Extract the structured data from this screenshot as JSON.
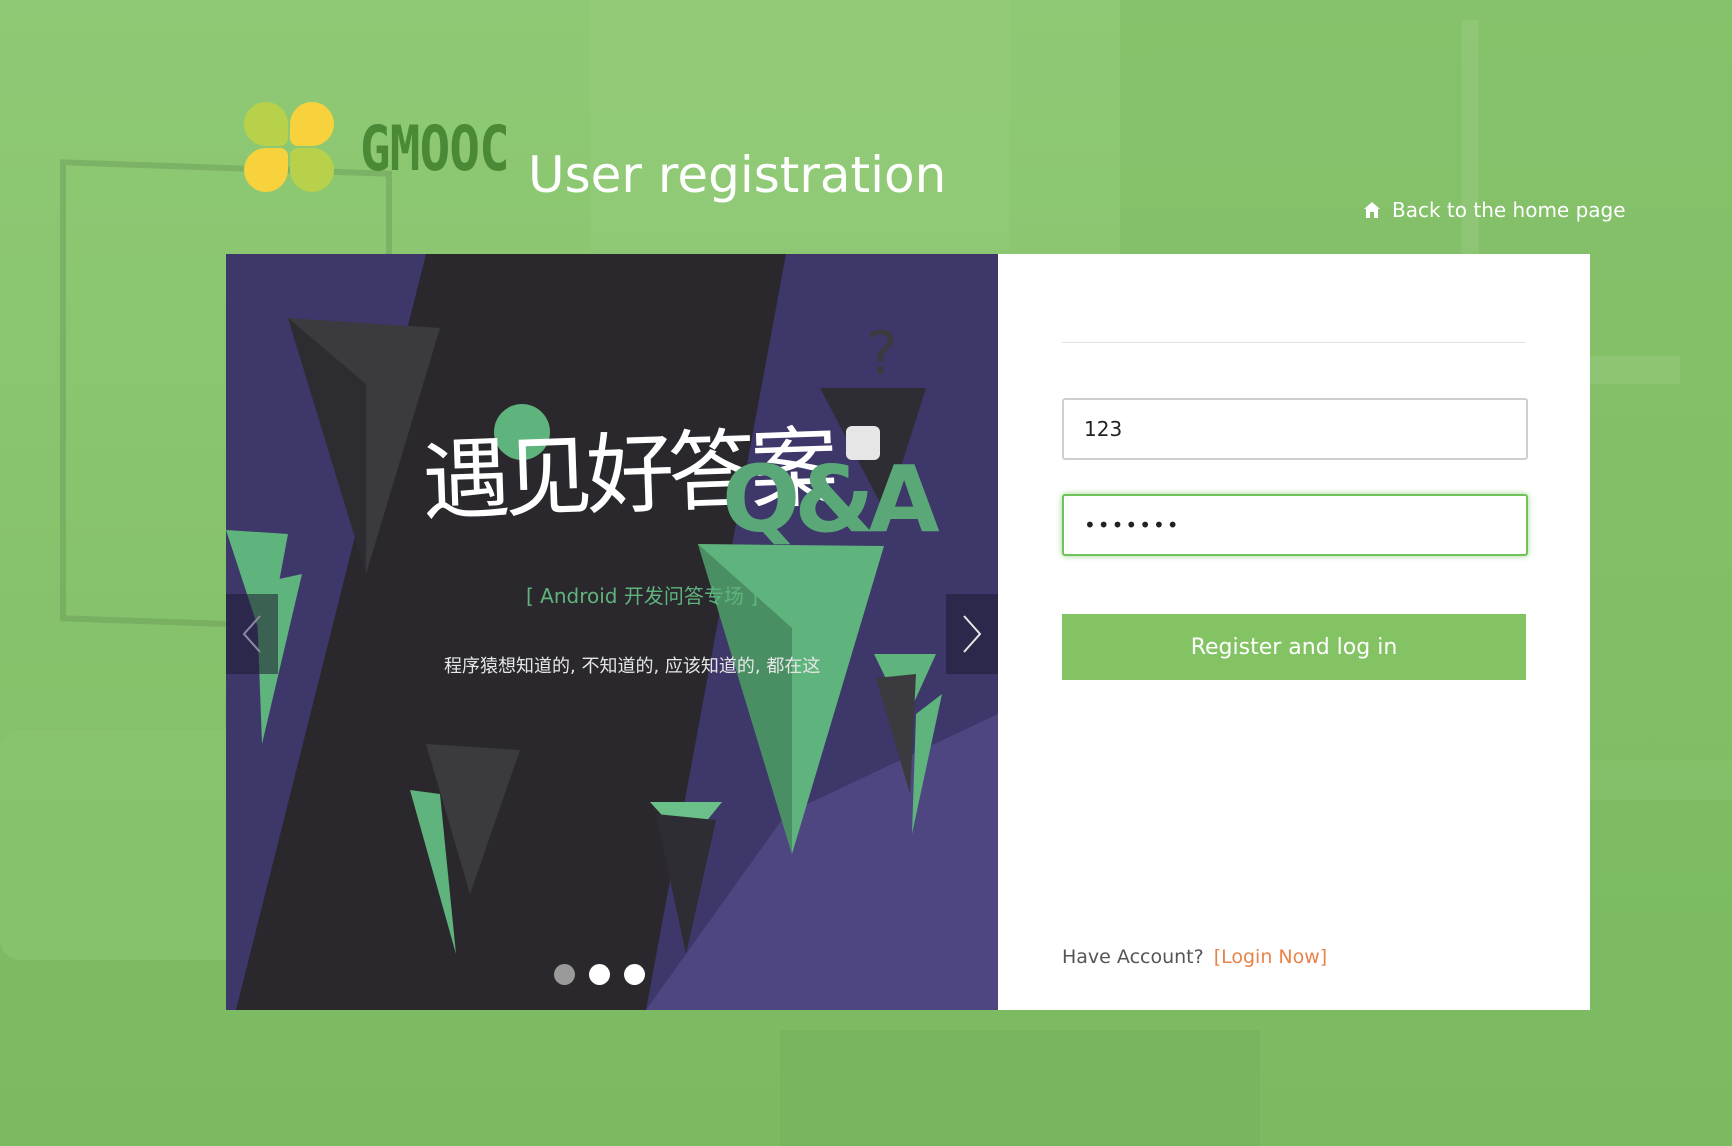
{
  "header": {
    "brand": "GMOOC",
    "title": "User registration",
    "home_link": "Back to the home page"
  },
  "carousel": {
    "headline": "遇见好答案",
    "subheadline": "[ Android 开发问答专场 ]",
    "tagline": "程序猿想知道的, 不知道的, 应该知道的, 都在这",
    "qa_mark": "Q&A",
    "dots": 3,
    "active_dot": 0
  },
  "form": {
    "username_value": "123",
    "password_value": "•••••••",
    "submit_label": "Register and log in",
    "have_account": "Have Account?",
    "login_link": "[Login Now]"
  },
  "colors": {
    "accent": "#84c364",
    "link": "#e8834a",
    "brand_text": "#4a8a36",
    "logo_green": "#b8d14a",
    "logo_yellow": "#f7d23d"
  },
  "icons": [
    "home-icon",
    "chevron-left-icon",
    "chevron-right-icon"
  ]
}
